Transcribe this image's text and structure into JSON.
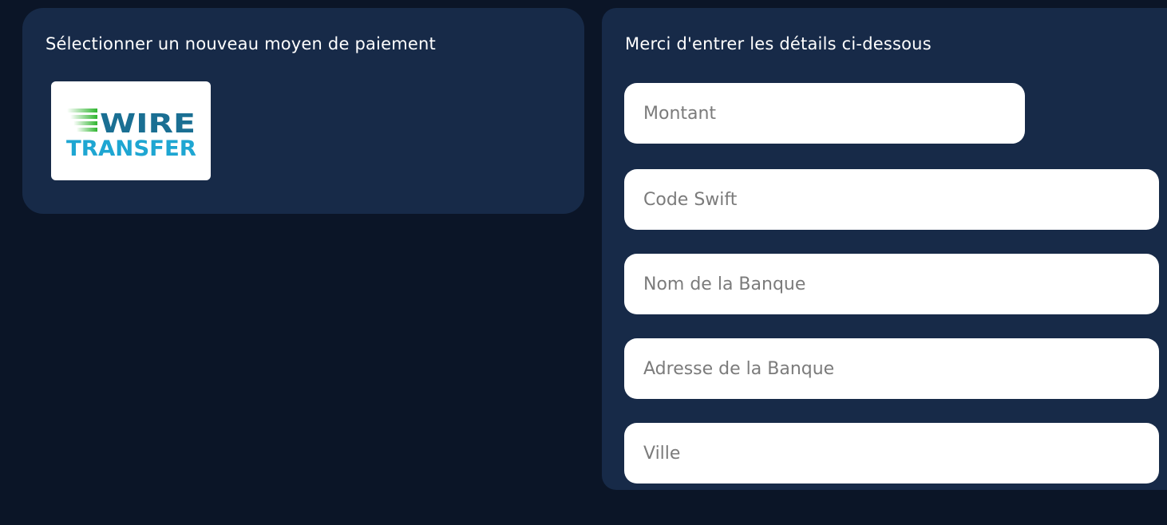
{
  "payment_methods": {
    "title": "Sélectionner un nouveau moyen de paiement",
    "methods": [
      {
        "logo_line1": "WIRE",
        "logo_line2": "TRANSFER",
        "icon": "wire-transfer-logo",
        "colors": {
          "line1": "#1a6f93",
          "line2": "#1ea6d2",
          "stripes": "#2fb52f"
        }
      }
    ]
  },
  "details_form": {
    "title": "Merci d'entrer les détails ci-dessous",
    "fields": {
      "amount": {
        "placeholder": "Montant",
        "value": ""
      },
      "swift": {
        "placeholder": "Code Swift",
        "value": ""
      },
      "bank_name": {
        "placeholder": "Nom de la Banque",
        "value": ""
      },
      "bank_address": {
        "placeholder": "Adresse de la Banque",
        "value": ""
      },
      "city": {
        "placeholder": "Ville",
        "value": ""
      }
    }
  },
  "colors": {
    "background": "#0b1527",
    "panel": "#172a48",
    "field_background": "#ffffff",
    "placeholder": "#7b7b7b"
  }
}
